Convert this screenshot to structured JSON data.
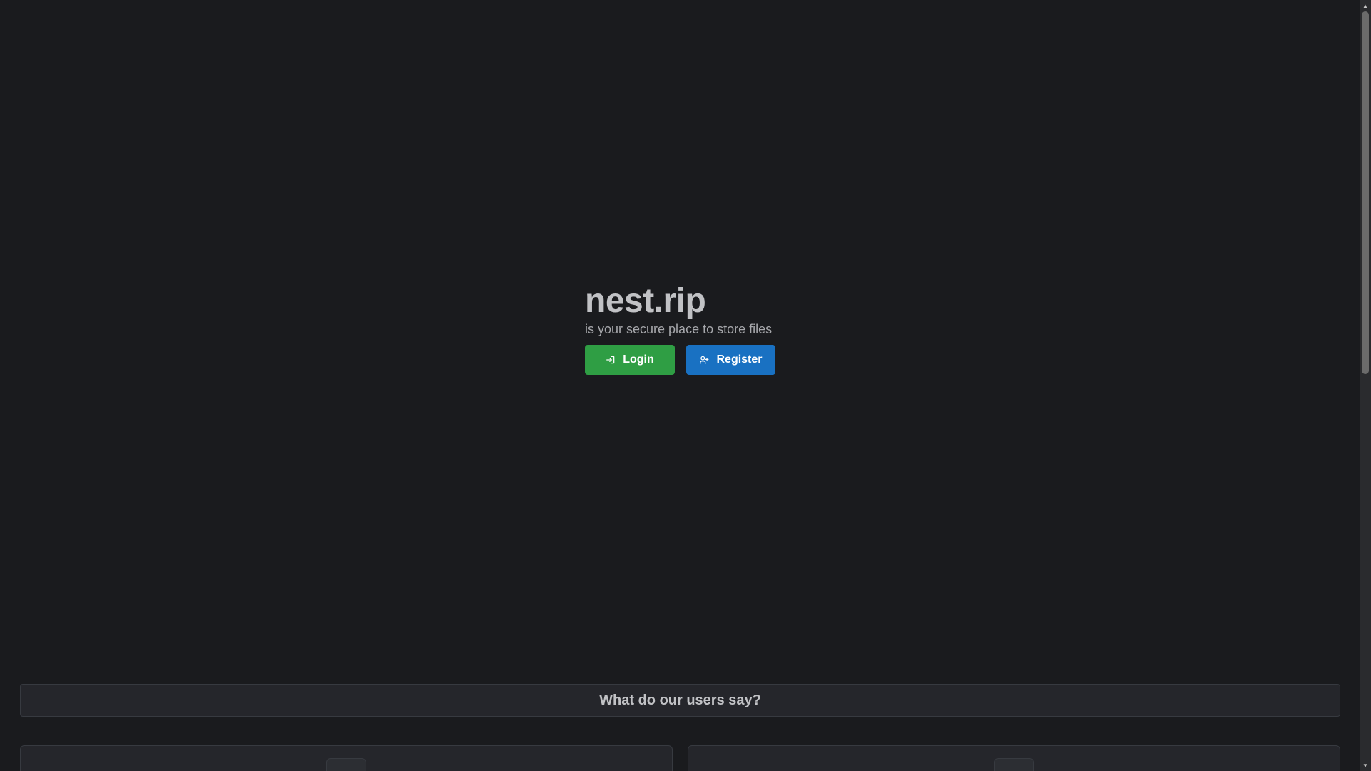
{
  "hero": {
    "title": "nest.rip",
    "subtitle": "is your secure place to store files",
    "login_label": "Login",
    "register_label": "Register",
    "login_icon": "login-icon",
    "register_icon": "user-plus-icon"
  },
  "testimonials": {
    "heading": "What do our users say?"
  },
  "colors": {
    "background": "#1a1b1e",
    "login": "#2f9e44",
    "register": "#1971c2",
    "panel": "#25262b"
  },
  "scrollbar": {
    "up_arrow": "▲",
    "down_arrow": "▼"
  }
}
